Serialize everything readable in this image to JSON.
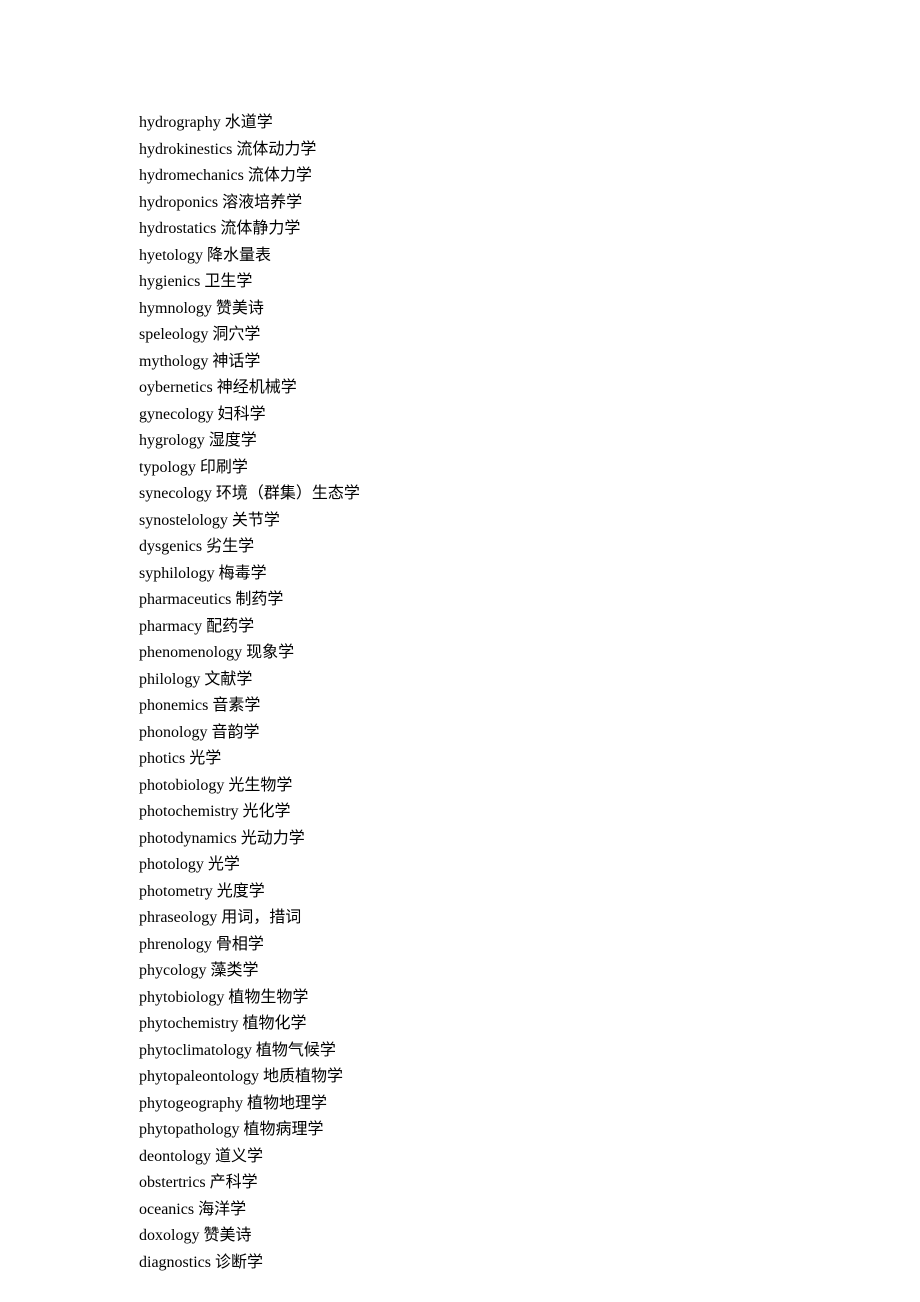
{
  "entries": [
    {
      "term": "hydrography",
      "definition": "水道学"
    },
    {
      "term": "hydrokinestics",
      "definition": "流体动力学"
    },
    {
      "term": "hydromechanics",
      "definition": "流体力学"
    },
    {
      "term": "hydroponics",
      "definition": "溶液培养学"
    },
    {
      "term": "hydrostatics",
      "definition": "流体静力学"
    },
    {
      "term": "hyetology",
      "definition": "降水量表"
    },
    {
      "term": "hygienics",
      "definition": "卫生学"
    },
    {
      "term": "hymnology",
      "definition": "赞美诗"
    },
    {
      "term": "speleology",
      "definition": "洞穴学"
    },
    {
      "term": "mythology",
      "definition": "神话学"
    },
    {
      "term": "oybernetics",
      "definition": "神经机械学"
    },
    {
      "term": "gynecology",
      "definition": "妇科学"
    },
    {
      "term": "hygrology",
      "definition": "湿度学"
    },
    {
      "term": "typology",
      "definition": "印刷学"
    },
    {
      "term": "synecology",
      "definition": "环境（群集）生态学"
    },
    {
      "term": "synostelology",
      "definition": "关节学"
    },
    {
      "term": "dysgenics",
      "definition": "劣生学"
    },
    {
      "term": "syphilology",
      "definition": "梅毒学"
    },
    {
      "term": "pharmaceutics",
      "definition": "制药学"
    },
    {
      "term": "pharmacy",
      "definition": "配药学"
    },
    {
      "term": "phenomenology",
      "definition": "现象学"
    },
    {
      "term": "philology",
      "definition": "文献学"
    },
    {
      "term": "phonemics",
      "definition": "音素学"
    },
    {
      "term": "phonology",
      "definition": "音韵学"
    },
    {
      "term": "photics",
      "definition": "光学"
    },
    {
      "term": "photobiology",
      "definition": "光生物学"
    },
    {
      "term": "photochemistry",
      "definition": "光化学"
    },
    {
      "term": "photodynamics",
      "definition": "光动力学"
    },
    {
      "term": "photology",
      "definition": "光学"
    },
    {
      "term": "photometry",
      "definition": "光度学"
    },
    {
      "term": "phraseology",
      "definition": "用词，措词"
    },
    {
      "term": "phrenology",
      "definition": "骨相学"
    },
    {
      "term": "phycology",
      "definition": "藻类学"
    },
    {
      "term": "phytobiology",
      "definition": "植物生物学"
    },
    {
      "term": "phytochemistry",
      "definition": "植物化学"
    },
    {
      "term": "phytoclimatology",
      "definition": "植物气候学"
    },
    {
      "term": "phytopaleontology",
      "definition": "地质植物学"
    },
    {
      "term": "phytogeography",
      "definition": "植物地理学"
    },
    {
      "term": "phytopathology",
      "definition": "植物病理学"
    },
    {
      "term": "deontology",
      "definition": "道义学"
    },
    {
      "term": "obstertrics",
      "definition": "产科学"
    },
    {
      "term": "oceanics",
      "definition": "海洋学"
    },
    {
      "term": "doxology",
      "definition": "赞美诗"
    },
    {
      "term": "diagnostics",
      "definition": "诊断学"
    }
  ]
}
